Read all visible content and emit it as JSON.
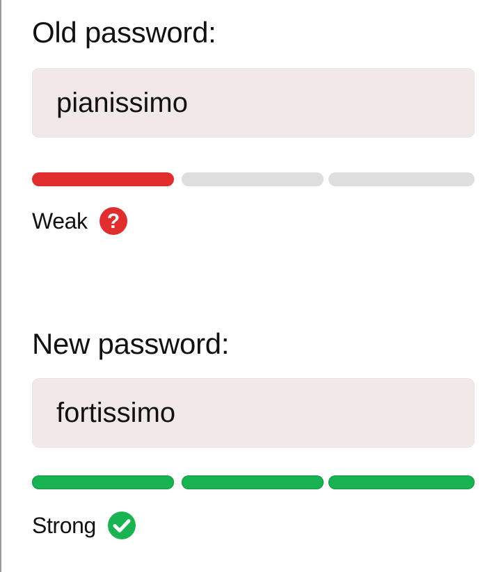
{
  "old_password": {
    "label": "Old password:",
    "value": "pianissimo",
    "strength": {
      "filled_segments": 1,
      "total_segments": 3,
      "color": "#e02e2e",
      "label": "Weak",
      "icon": "question-circle-icon",
      "icon_color": "#e02e2e"
    }
  },
  "new_password": {
    "label": "New password:",
    "value": "fortissimo",
    "strength": {
      "filled_segments": 3,
      "total_segments": 3,
      "color": "#19b451",
      "label": "Strong",
      "icon": "check-circle-icon",
      "icon_color": "#19b451"
    }
  }
}
